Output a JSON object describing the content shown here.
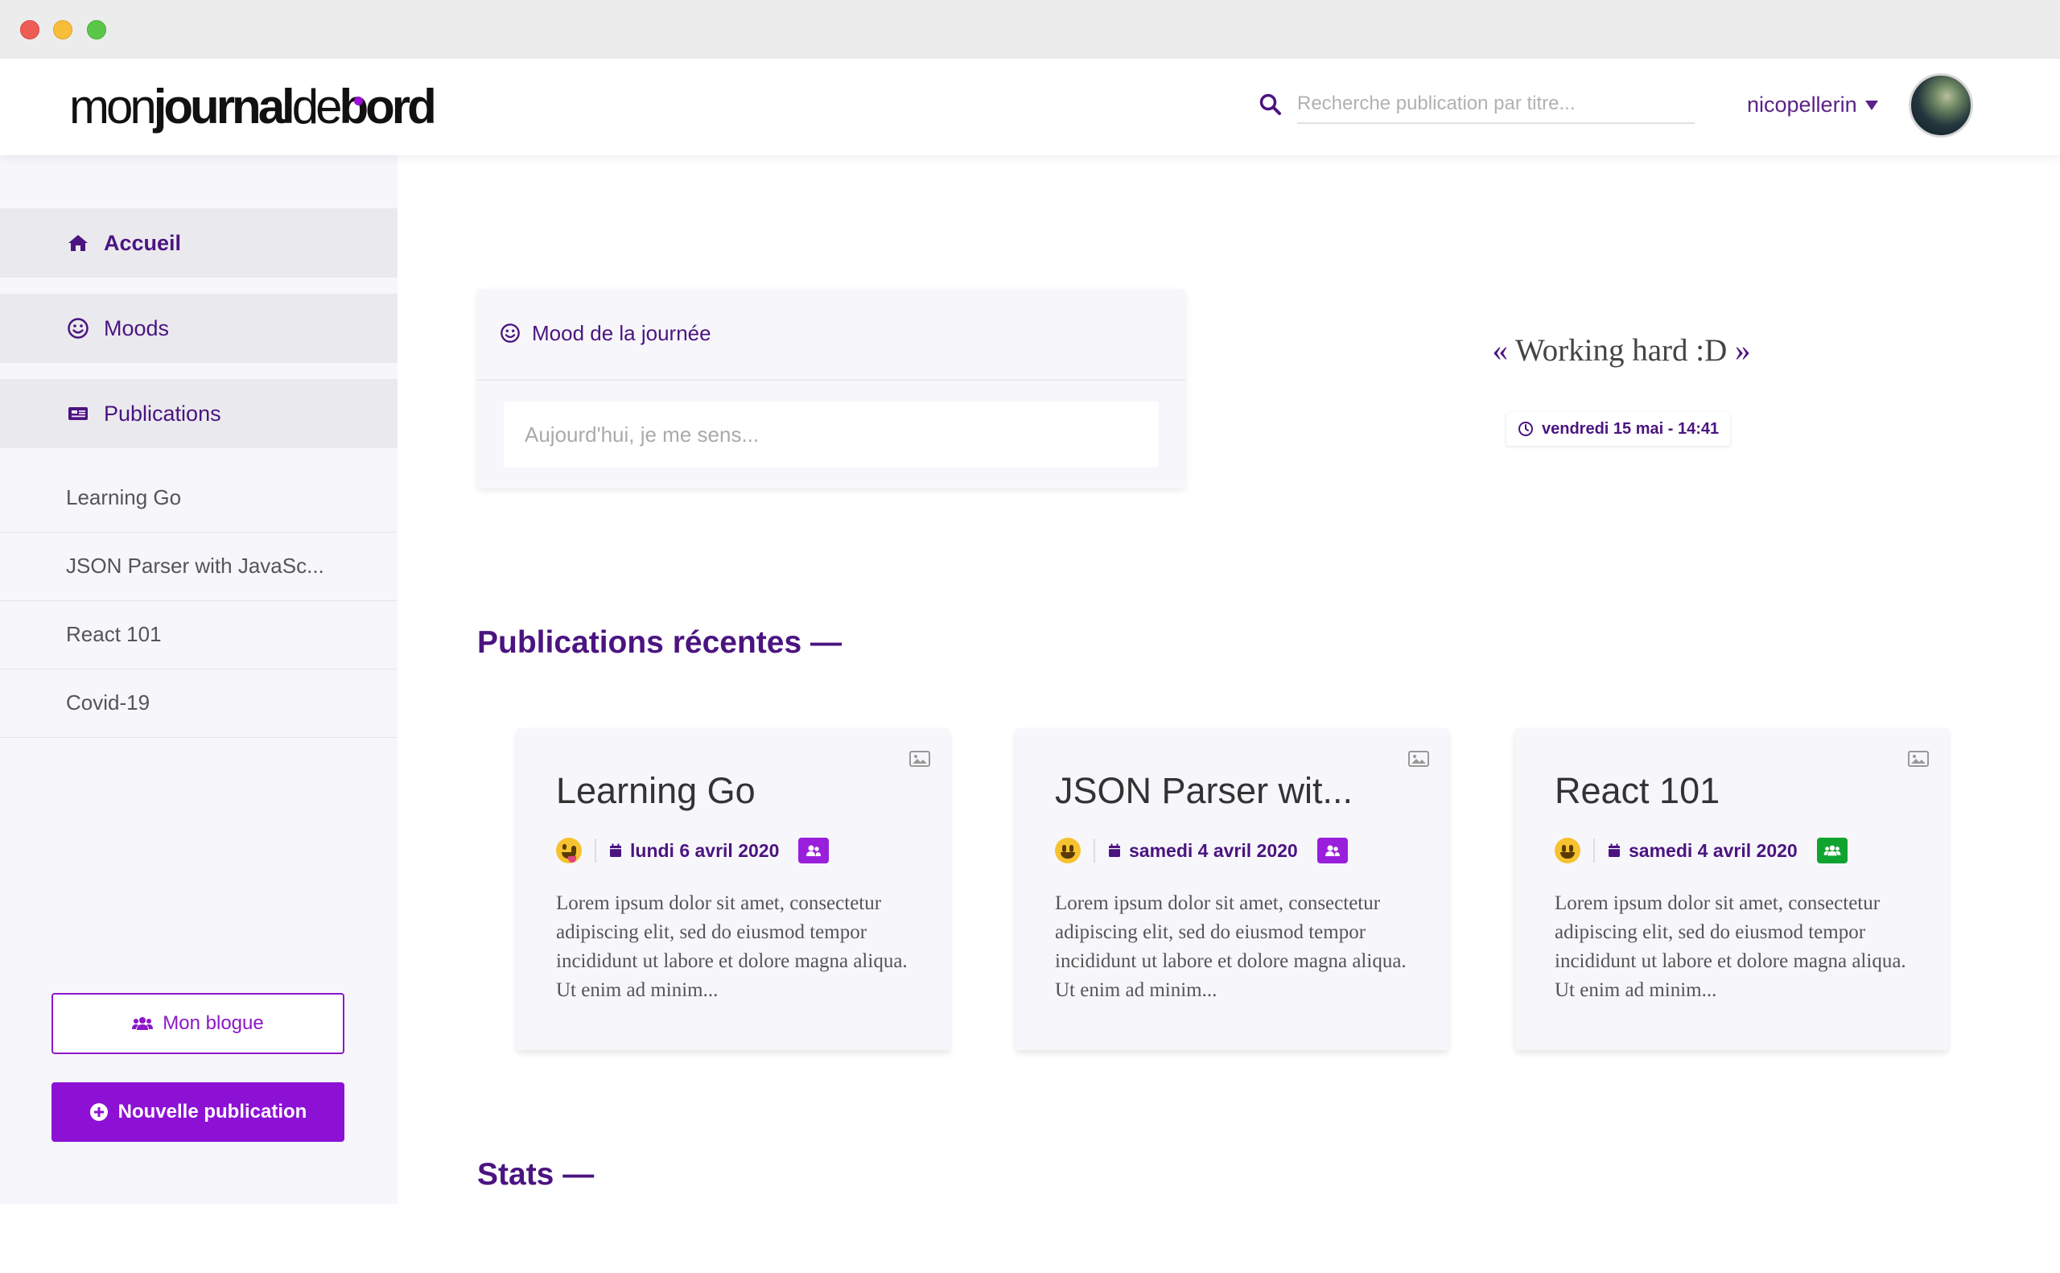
{
  "header": {
    "logo": {
      "part1": "mon",
      "part2": "journal",
      "part3": "de",
      "part4": "bord"
    },
    "search_placeholder": "Recherche publication par titre...",
    "username": "nicopellerin"
  },
  "sidebar": {
    "nav": [
      {
        "label": "Accueil",
        "icon": "home-icon"
      },
      {
        "label": "Moods",
        "icon": "smile-icon"
      },
      {
        "label": "Publications",
        "icon": "newspaper-icon"
      }
    ],
    "publications": [
      "Learning Go",
      "JSON Parser with JavaSc...",
      "React 101",
      "Covid-19"
    ],
    "blog_button": "Mon blogue",
    "new_button": "Nouvelle publication"
  },
  "mood": {
    "title": "Mood de la journée",
    "placeholder": "Aujourd'hui, je me sens...",
    "quote": "Working hard :D",
    "quote_open": "«",
    "quote_close": "»",
    "date": "vendredi 15 mai - 14:41"
  },
  "sections": {
    "recent": "Publications récentes —",
    "stats": "Stats —"
  },
  "cards": [
    {
      "title": "Learning Go",
      "emoji": "zany-face",
      "date": "lundi 6 avril 2020",
      "badge_color": "#9a1fdc",
      "badge_icon": "user-friends-icon",
      "excerpt": "Lorem ipsum dolor sit amet, consectetur adipiscing elit, sed do eiusmod tempor incididunt ut labore et dolore magna aliqua. Ut enim ad minim..."
    },
    {
      "title": "JSON Parser wit...",
      "emoji": "grinning-face",
      "date": "samedi 4 avril 2020",
      "badge_color": "#9a1fdc",
      "badge_icon": "user-friends-icon",
      "excerpt": "Lorem ipsum dolor sit amet, consectetur adipiscing elit, sed do eiusmod tempor incididunt ut labore et dolore magna aliqua. Ut enim ad minim..."
    },
    {
      "title": "React 101",
      "emoji": "grinning-face",
      "date": "samedi 4 avril 2020",
      "badge_color": "#11a32f",
      "badge_icon": "users-icon",
      "excerpt": "Lorem ipsum dolor sit amet, consectetur adipiscing elit, sed do eiusmod tempor incididunt ut labore et dolore magna aliqua. Ut enim ad minim..."
    }
  ],
  "colors": {
    "accent": "#8d11d4",
    "primary_text": "#4b1480",
    "sidebar_bg": "#f7f7fb"
  }
}
